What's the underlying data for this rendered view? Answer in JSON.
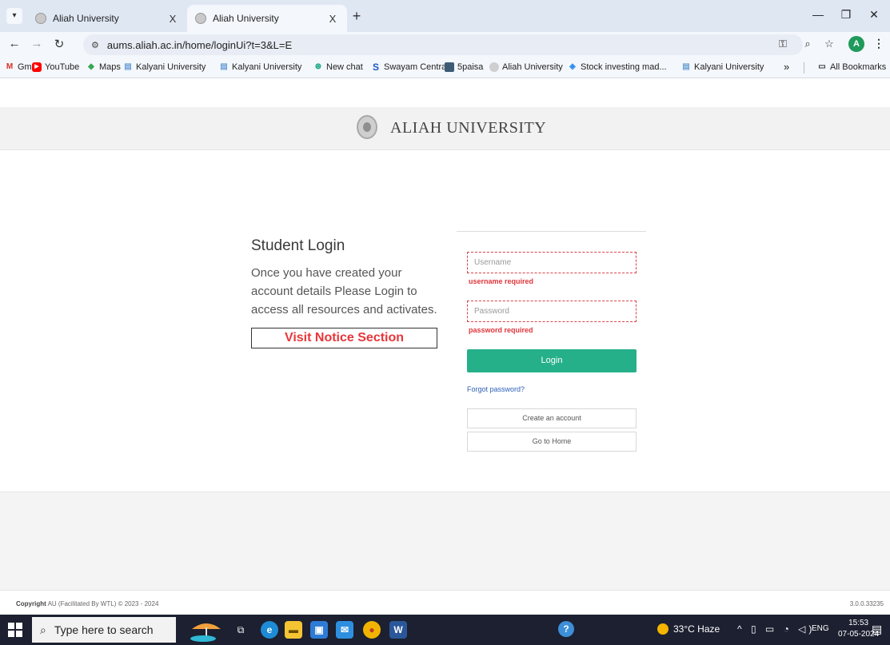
{
  "browser": {
    "tabs": [
      {
        "title": "Aliah University",
        "active": false
      },
      {
        "title": "Aliah University",
        "active": true
      }
    ],
    "tab_close_glyph": "X",
    "new_tab_glyph": "+",
    "address": "aums.aliah.ac.in/home/loginUi?t=3&L=E",
    "profile_initial": "A",
    "bookmarks": [
      {
        "label": "Gmail",
        "icon": "gmail-icon",
        "color": "#d93025"
      },
      {
        "label": "YouTube",
        "icon": "youtube-icon",
        "color": "#ff0000"
      },
      {
        "label": "Maps",
        "icon": "maps-icon",
        "color": "#34a853"
      },
      {
        "label": "Kalyani University",
        "icon": "document-icon",
        "color": "#6aa0d8"
      },
      {
        "label": "Kalyani University",
        "icon": "document-icon",
        "color": "#6aa0d8"
      },
      {
        "label": "New chat",
        "icon": "chat-icon",
        "color": "#10a37f"
      },
      {
        "label": "Swayam Central",
        "icon": "swayam-icon",
        "color": "#1a56c4"
      },
      {
        "label": "5paisa",
        "icon": "5paisa-icon",
        "color": "#3e5b76"
      },
      {
        "label": "Aliah University",
        "icon": "university-icon",
        "color": "#9a9a9a"
      },
      {
        "label": "Stock investing mad...",
        "icon": "stock-icon",
        "color": "#2d8cf0"
      },
      {
        "label": "Kalyani University",
        "icon": "document-icon",
        "color": "#6aa0d8"
      }
    ],
    "more_bookmarks": "»",
    "all_bookmarks": "All Bookmarks"
  },
  "site": {
    "title": "ALIAH UNIVERSITY"
  },
  "login": {
    "heading": "Student Login",
    "description": "Once you have created your account details Please Login to access all resources and activates.",
    "notice_button": "Visit Notice Section",
    "username_placeholder": "Username",
    "username_error": "username required",
    "password_placeholder": "Password",
    "password_error": "password required",
    "login_button": "Login",
    "forgot_password": "Forgot password?",
    "create_account": "Create an account",
    "go_home": "Go to Home"
  },
  "footer": {
    "copyright_bold": "Copyright",
    "copyright_text": "AU (Facilitated By WTL) © 2023 - 2024",
    "version": "3.0.0.33235"
  },
  "taskbar": {
    "search_placeholder": "Type here to search",
    "weather": "33°C  Haze",
    "language": "ENG",
    "time": "15:53",
    "date": "07-05-2024"
  },
  "colors": {
    "accent_green": "#26b08a",
    "error_red": "#e0353b",
    "notice_red": "#e8363a"
  }
}
